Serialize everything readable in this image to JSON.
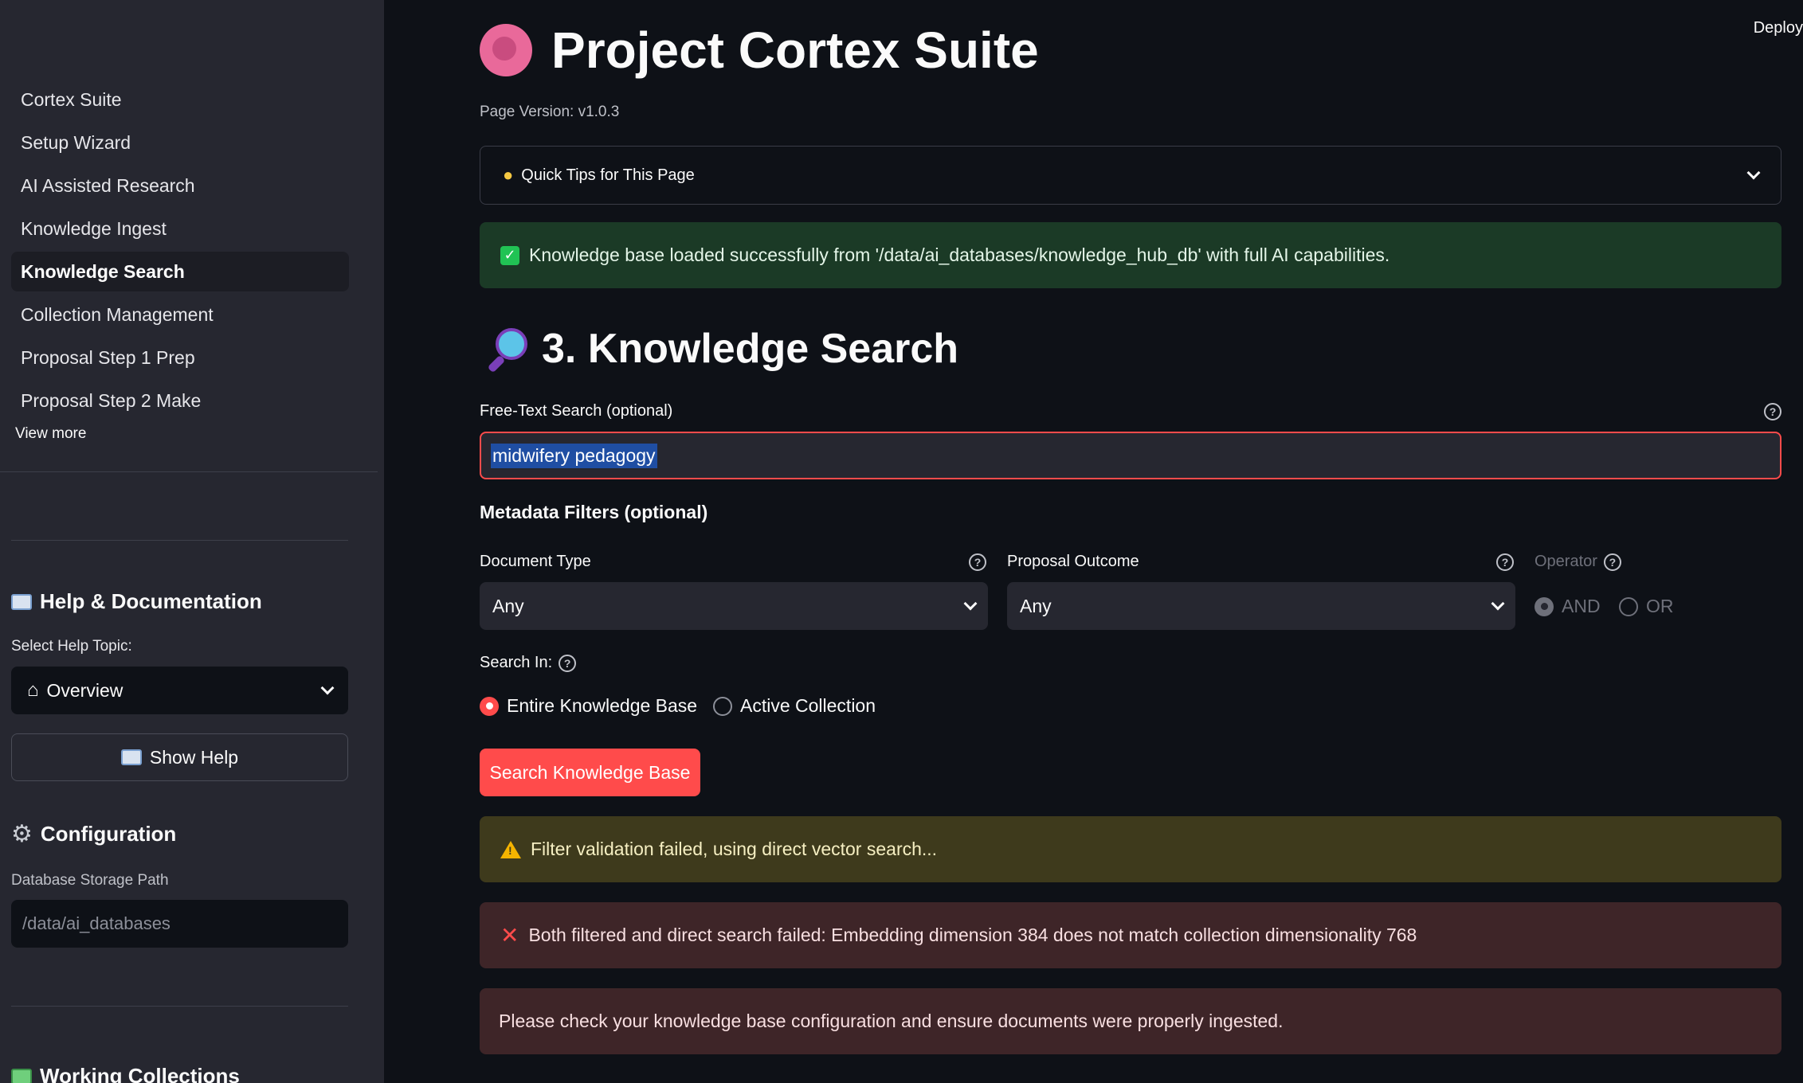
{
  "sidebar": {
    "nav_items": [
      {
        "label": "Cortex Suite"
      },
      {
        "label": "Setup Wizard"
      },
      {
        "label": "AI Assisted Research"
      },
      {
        "label": "Knowledge Ingest"
      },
      {
        "label": "Knowledge Search",
        "active": true
      },
      {
        "label": "Collection Management"
      },
      {
        "label": "Proposal Step 1 Prep"
      },
      {
        "label": "Proposal Step 2 Make"
      }
    ],
    "view_more": "View more",
    "help_heading": "Help & Documentation",
    "help_topic_label": "Select Help Topic:",
    "help_topic_value": "Overview",
    "show_help_label": "Show Help",
    "config_heading": "Configuration",
    "db_path_label": "Database Storage Path",
    "db_path_placeholder": "/data/ai_databases",
    "working_collections_heading": "Working Collections"
  },
  "header": {
    "deploy_label": "Deploy",
    "app_title": "Project Cortex Suite",
    "page_version": "Page Version: v1.0.3"
  },
  "main": {
    "quick_tips_label": "Quick Tips for This Page",
    "success_message": "Knowledge base loaded successfully from '/data/ai_databases/knowledge_hub_db' with full AI capabilities.",
    "section_title": "3. Knowledge Search",
    "search_label": "Free-Text Search (optional)",
    "search_value": "midwifery pedagogy",
    "metadata_header": "Metadata Filters (optional)",
    "document_type_label": "Document Type",
    "document_type_value": "Any",
    "proposal_outcome_label": "Proposal Outcome",
    "proposal_outcome_value": "Any",
    "operator_label": "Operator",
    "operator_options": [
      "AND",
      "OR"
    ],
    "operator_selected": "AND",
    "search_in_label": "Search In:",
    "search_in_options": [
      "Entire Knowledge Base",
      "Active Collection"
    ],
    "search_in_selected": "Entire Knowledge Base",
    "search_button_label": "Search Knowledge Base",
    "warning_message": "Filter validation failed, using direct vector search...",
    "error_message": "Both filtered and direct search failed: Embedding dimension 384 does not match collection dimensionality 768",
    "error_hint": "Please check your knowledge base configuration and ensure documents were properly ingested."
  },
  "colors": {
    "accent": "#ff4b4b",
    "background": "#0e1117",
    "sidebar": "#262730",
    "success_bg": "#1b3a26",
    "warning_bg": "#3e3a1c",
    "error_bg": "#3e2528"
  }
}
